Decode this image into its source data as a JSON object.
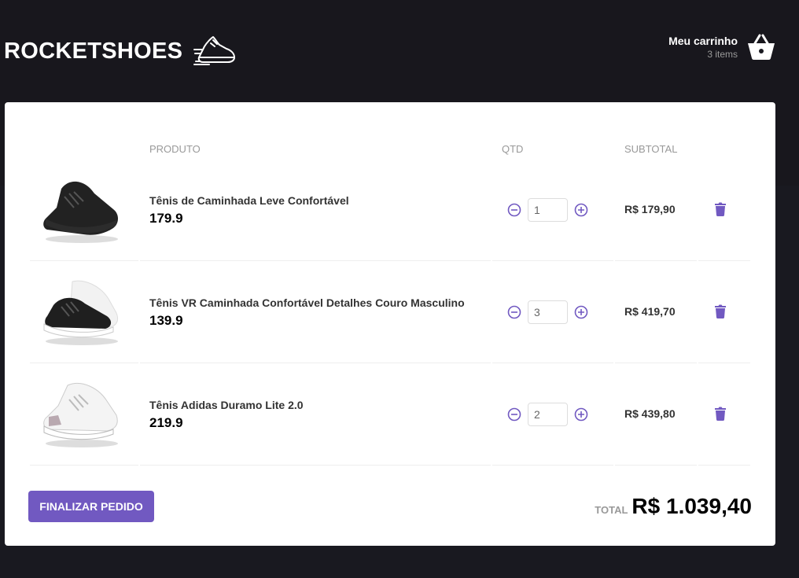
{
  "header": {
    "logo_text": "ROCKETSHOES",
    "logo_icon": "running-shoe-icon",
    "cart_title": "Meu carrinho",
    "cart_count": "3 items",
    "cart_icon": "shopping-basket-icon"
  },
  "table": {
    "headers": {
      "product": "PRODUTO",
      "qty": "QTD",
      "subtotal": "SUBTOTAL"
    },
    "rows": [
      {
        "title": "Tênis de Caminhada Leve Confortável",
        "price": "179.9",
        "qty": "1",
        "subtotal": "R$ 179,90",
        "variant": "black"
      },
      {
        "title": "Tênis VR Caminhada Confortável Detalhes Couro Masculino",
        "price": "139.9",
        "qty": "3",
        "subtotal": "R$ 419,70",
        "variant": "black-white"
      },
      {
        "title": "Tênis Adidas Duramo Lite 2.0",
        "price": "219.9",
        "qty": "2",
        "subtotal": "R$ 439,80",
        "variant": "white"
      }
    ]
  },
  "footer": {
    "button_label": "FINALIZAR PEDIDO",
    "total_label": "TOTAL",
    "total_value": "R$ 1.039,40"
  },
  "colors": {
    "accent": "#7159c1",
    "background": "#191920"
  }
}
